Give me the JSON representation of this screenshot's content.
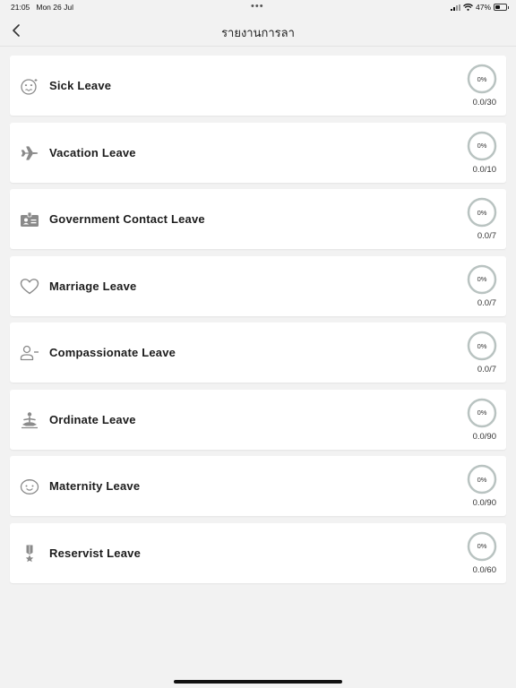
{
  "status_bar": {
    "time": "21:05",
    "date": "Mon 26 Jul",
    "dots": "•••",
    "battery_percent": "47%",
    "battery_level": 0.47
  },
  "nav": {
    "title": "รายงานการลา"
  },
  "leave_types": [
    {
      "label": "Sick Leave",
      "icon": "sick-face-icon",
      "percent": "0%",
      "usage": "0.0/30"
    },
    {
      "label": "Vacation Leave",
      "icon": "airplane-icon",
      "percent": "0%",
      "usage": "0.0/10"
    },
    {
      "label": "Government Contact Leave",
      "icon": "id-card-icon",
      "percent": "0%",
      "usage": "0.0/7"
    },
    {
      "label": "Marriage Leave",
      "icon": "heart-icon",
      "percent": "0%",
      "usage": "0.0/7"
    },
    {
      "label": "Compassionate Leave",
      "icon": "person-minus-icon",
      "percent": "0%",
      "usage": "0.0/7"
    },
    {
      "label": "Ordinate Leave",
      "icon": "meditation-icon",
      "percent": "0%",
      "usage": "0.0/90"
    },
    {
      "label": "Maternity Leave",
      "icon": "baby-face-icon",
      "percent": "0%",
      "usage": "0.0/90"
    },
    {
      "label": "Reservist Leave",
      "icon": "medal-icon",
      "percent": "0%",
      "usage": "0.0/60"
    }
  ],
  "colors": {
    "ring": "#b9c3c1",
    "icon": "#8a8a8a",
    "background": "#f2f2f2"
  }
}
